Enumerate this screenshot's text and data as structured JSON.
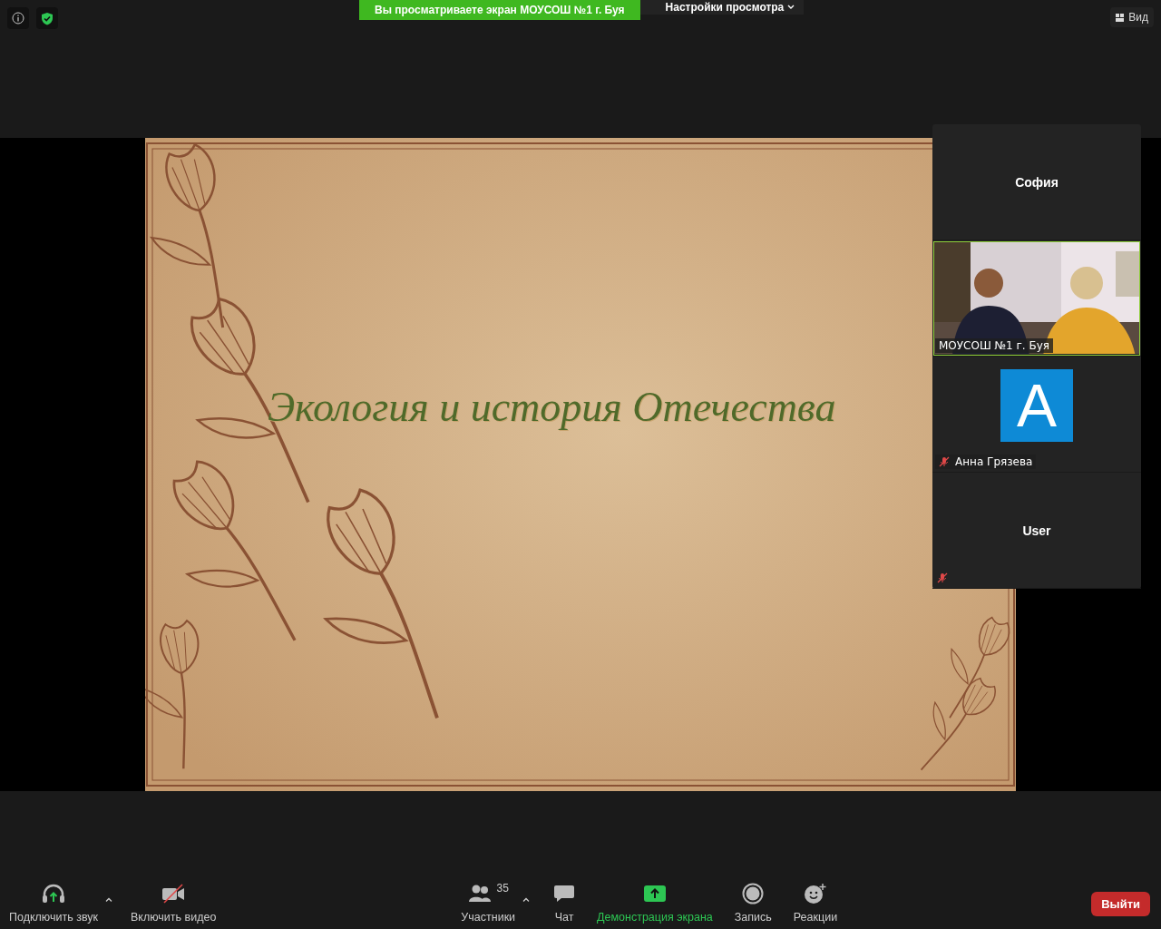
{
  "top_bar": {
    "sharing_banner": "Вы просматриваете экран МОУСОШ №1 г. Буя",
    "view_options": "Настройки просмотра",
    "view_button": "Вид"
  },
  "slide": {
    "title": "Экология и история Отечества"
  },
  "participants": [
    {
      "kind": "name",
      "name": "София",
      "muted": false
    },
    {
      "kind": "video",
      "name": "МОУСОШ №1 г. Буя",
      "speaking": true
    },
    {
      "kind": "avatar",
      "initial": "A",
      "name": "Анна Грязева",
      "muted": true
    },
    {
      "kind": "name",
      "name": "User",
      "muted": true
    }
  ],
  "toolbar": {
    "left": [
      {
        "kind": "audio",
        "label": "Подключить звук",
        "menu": true,
        "active": false
      },
      {
        "kind": "video",
        "label": "Включить видео",
        "menu": false,
        "active": false
      }
    ],
    "center": [
      {
        "kind": "participants",
        "label": "Участники",
        "count": "35",
        "menu": true,
        "active": false
      },
      {
        "kind": "chat",
        "label": "Чат",
        "menu": false,
        "active": false
      },
      {
        "kind": "share",
        "label": "Демонстрация экрана",
        "menu": false,
        "active": true
      },
      {
        "kind": "record",
        "label": "Запись",
        "menu": false,
        "active": false
      },
      {
        "kind": "reactions",
        "label": "Реакции",
        "menu": false,
        "active": false
      }
    ],
    "leave_button": "Выйти"
  }
}
